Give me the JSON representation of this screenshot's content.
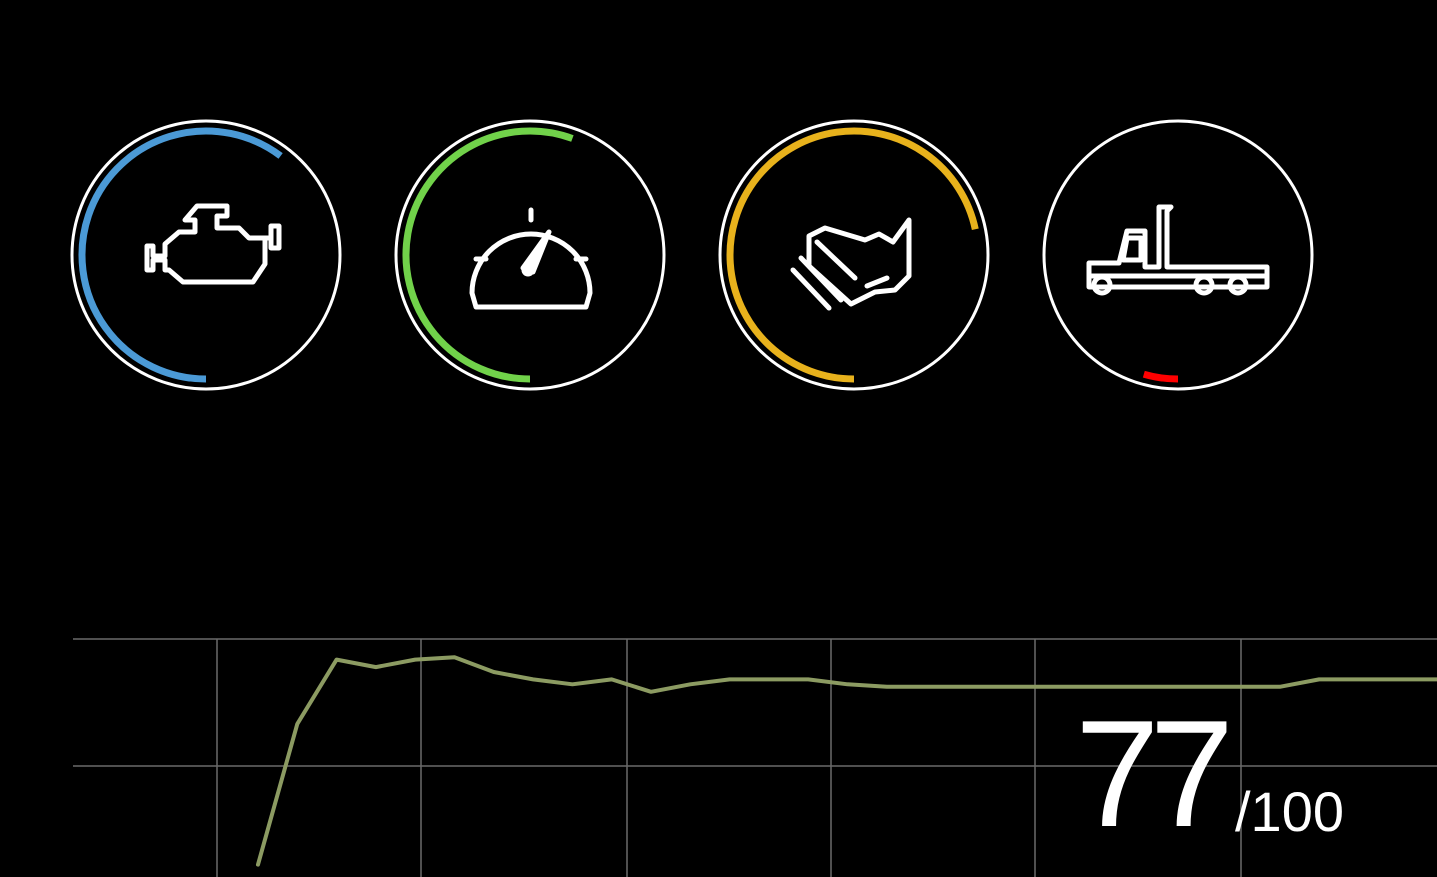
{
  "gauges": [
    {
      "id": "engine",
      "icon": "engine-icon",
      "color": "#4b9ad6",
      "start_deg": 180,
      "end_deg": 397
    },
    {
      "id": "speed",
      "icon": "speedometer-icon",
      "color": "#71d24a",
      "start_deg": 180,
      "end_deg": 380
    },
    {
      "id": "handling",
      "icon": "handshake-icon",
      "color": "#e8b21c",
      "start_deg": 180,
      "end_deg": 438
    },
    {
      "id": "truck",
      "icon": "truck-icon",
      "color": "#ff0000",
      "start_deg": 180,
      "end_deg": 196
    }
  ],
  "score": {
    "value": "77",
    "max": "/100"
  },
  "chart_data": {
    "type": "line",
    "color": "#8c9b62",
    "grid": true,
    "ylim": [
      0,
      100
    ],
    "x": [
      0,
      10,
      20,
      30,
      40,
      50,
      60,
      70,
      80,
      90,
      100,
      110,
      120,
      130,
      140,
      150,
      160,
      170,
      180,
      190,
      200,
      210,
      220,
      230,
      240,
      250,
      260,
      270,
      280,
      290,
      300
    ],
    "values": [
      5,
      62,
      88,
      85,
      88,
      89,
      83,
      80,
      78,
      80,
      75,
      78,
      80,
      80,
      80,
      78,
      77,
      77,
      77,
      77,
      77,
      77,
      77,
      77,
      77,
      77,
      77,
      80,
      80,
      80,
      80
    ]
  }
}
